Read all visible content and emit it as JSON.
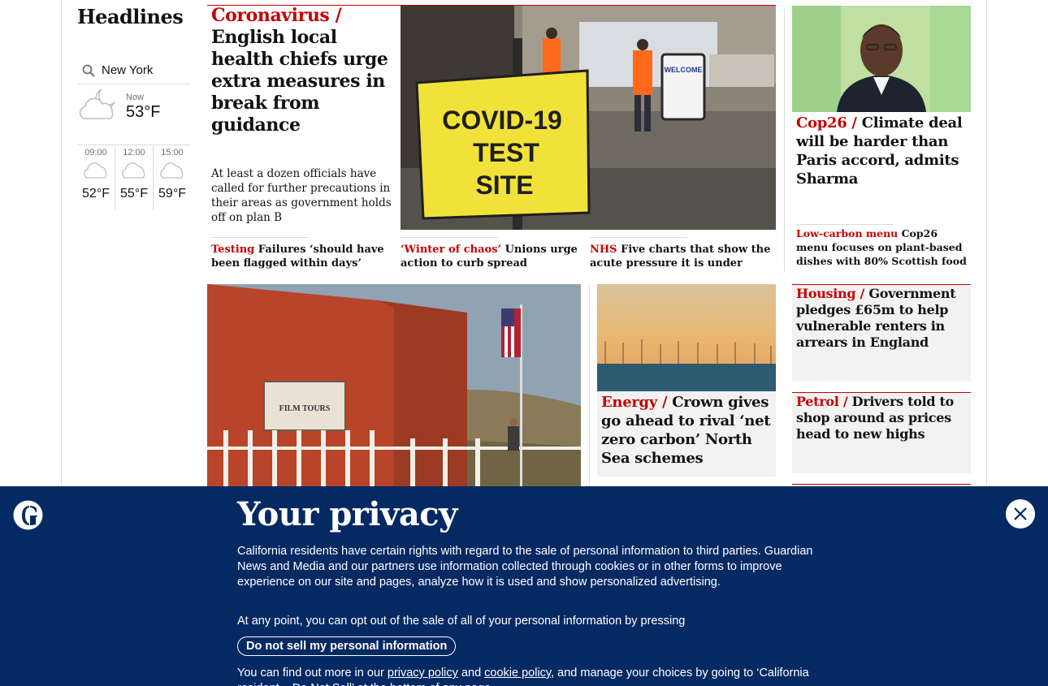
{
  "sidebar": {
    "title": "Headlines",
    "weather": {
      "location": "New York",
      "now_label": "Now",
      "now_temp": "53°F",
      "forecast": [
        {
          "time": "09:00",
          "temp": "52°F"
        },
        {
          "time": "12:00",
          "temp": "55°F"
        },
        {
          "time": "15:00",
          "temp": "59°F"
        }
      ]
    }
  },
  "lead": {
    "kicker": "Coronavirus /",
    "headline": "English local health chiefs urge extra measures in break from guidance",
    "standfirst": "At least a dozen officials have called for further precautions in their areas as government holds off on plan B",
    "image_sign_text": "COVID-19 TEST SITE",
    "image_welcome_text": "WELCOME",
    "sublinks": [
      {
        "kicker": "Testing",
        "text": "Failures ‘should have been flagged within days’"
      },
      {
        "kicker": "‘Winter of chaos’",
        "text": "Unions urge action to curb spread"
      },
      {
        "kicker": "NHS",
        "text": "Five charts that show the acute pressure it is under"
      }
    ]
  },
  "right": {
    "cop26": {
      "kicker": "Cop26 /",
      "headline": "Climate deal will be harder than Paris accord, admits Sharma",
      "sub_kicker": "Low-carbon menu",
      "sub_text": "Cop26 menu focuses on plant-based dishes with 80% Scottish food"
    },
    "housing": {
      "kicker": "Housing /",
      "headline": "Government pledges £65m to help vulnerable renters in arrears in England"
    },
    "petrol": {
      "kicker": "Petrol /",
      "headline": "Drivers told to shop around as prices head to new highs"
    }
  },
  "second_row": {
    "desert_sign_text": "FILM TOURS",
    "energy": {
      "kicker": "Energy /",
      "headline": "Crown gives go ahead to rival ‘net zero carbon’ North Sea schemes"
    }
  },
  "privacy": {
    "title": "Your privacy",
    "para1": "California residents have certain rights with regard to the sale of personal information to third parties. Guardian News and Media and our partners use information collected through cookies or in other forms to improve experience on our site and pages, analyze how it is used and show personalized advertising.",
    "para2": "At any point, you can opt out of the sale of all of your personal information by pressing",
    "button": "Do not sell my personal information",
    "para3_a": "You can find out more in our",
    "link_privacy": "privacy policy",
    "para3_and": "and",
    "link_cookie": "cookie policy",
    "para3_b": ", and manage your choices by going to ‘California resident – Do Not Sell’ at the bottom of any page."
  },
  "colors": {
    "accent": "#c70000",
    "banner": "#052962",
    "card_bg": "#f2f2f2"
  }
}
